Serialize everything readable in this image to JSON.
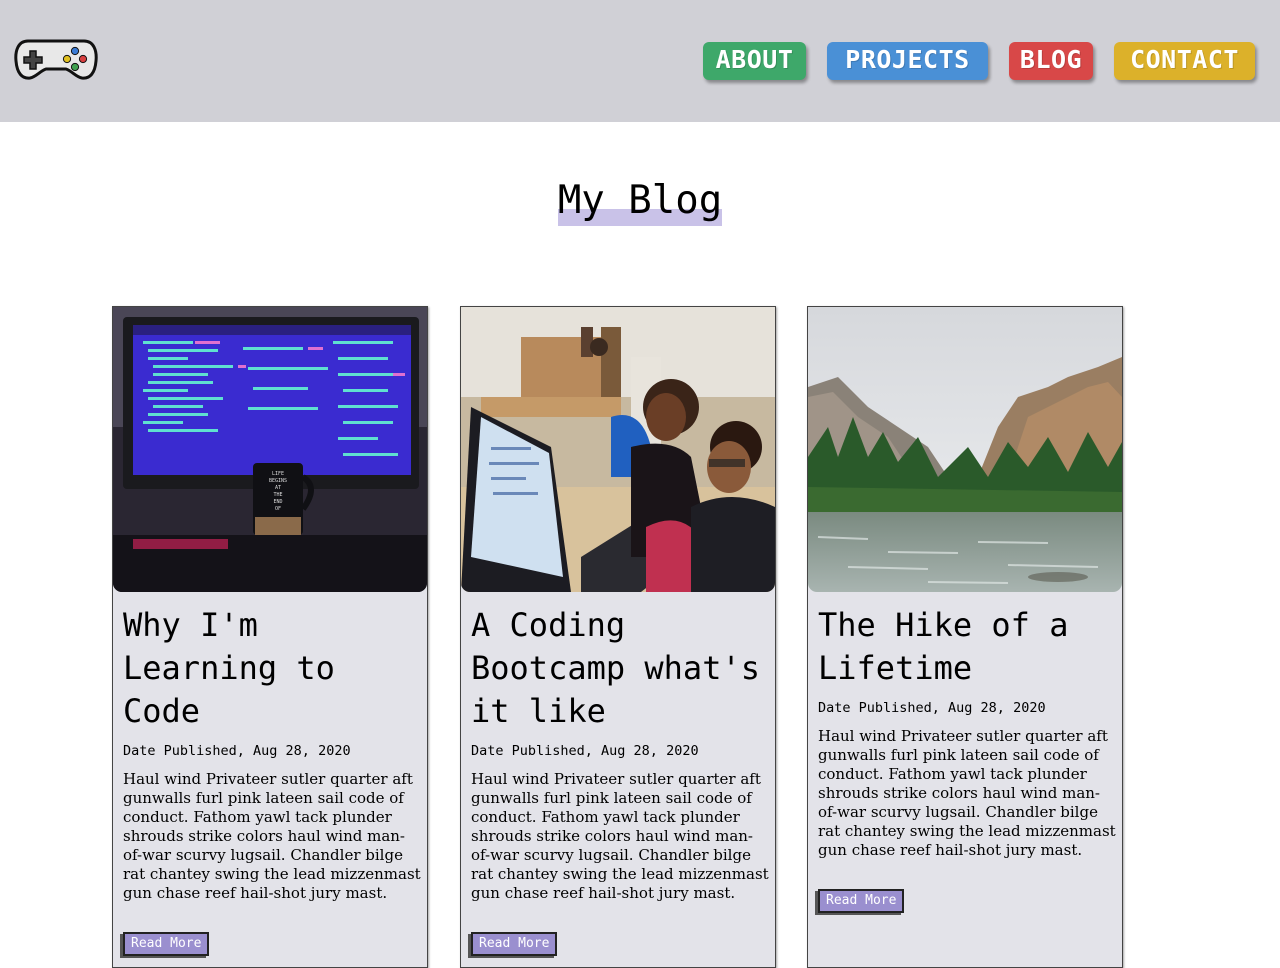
{
  "header": {
    "logo_icon": "gamepad-icon",
    "nav": [
      {
        "label": "ABOUT",
        "color": "#3ea86a"
      },
      {
        "label": "PROJECTS",
        "color": "#4a90d6"
      },
      {
        "label": "BLOG",
        "color": "#d84848"
      },
      {
        "label": "CONTACT",
        "color": "#dcb12a"
      }
    ]
  },
  "page": {
    "title": "My Blog",
    "highlight_color": "#c9c2e8"
  },
  "posts": [
    {
      "title": "Why I'm Learning to Code",
      "date": "Date Published, Aug 28, 2020",
      "body": "Haul wind Privateer sutler quarter aft gunwalls furl pink lateen sail code of conduct. Fathom yawl tack plunder shrouds strike colors haul wind man-of-war scurvy lugsail. Chandler bilge rat chantey swing the lead mizzenmast gun chase reef hail-shot jury mast.",
      "read_more": "Read More",
      "image": "computer-monitor-with-code-photo"
    },
    {
      "title": "A Coding Bootcamp what's it like",
      "date": "Date Published, Aug 28, 2020",
      "body": "Haul wind Privateer sutler quarter aft gunwalls furl pink lateen sail code of conduct. Fathom yawl tack plunder shrouds strike colors haul wind man-of-war scurvy lugsail. Chandler bilge rat chantey swing the lead mizzenmast gun chase reef hail-shot jury mast.",
      "read_more": "Read More",
      "image": "people-coding-on-laptop-photo"
    },
    {
      "title": "The Hike of a Lifetime",
      "date": "Date Published, Aug 28, 2020",
      "body": "Haul wind Privateer sutler quarter aft gunwalls furl pink lateen sail code of conduct. Fathom yawl tack plunder shrouds strike colors haul wind man-of-war scurvy lugsail. Chandler bilge rat chantey swing the lead mizzenmast gun chase reef hail-shot jury mast.",
      "read_more": "Read More",
      "image": "mountain-river-landscape-photo"
    }
  ]
}
